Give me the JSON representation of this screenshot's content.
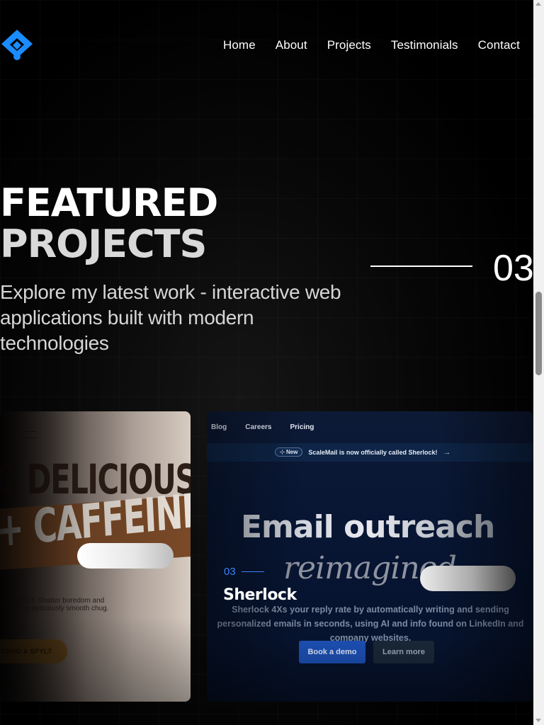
{
  "nav": {
    "items": [
      "Home",
      "About",
      "Projects",
      "Testimonials",
      "Contact"
    ]
  },
  "logo": {
    "icon": "diamond-logo-icon",
    "color": "#1a8cff"
  },
  "hero": {
    "title_line1": "FEATURED",
    "title_line2": "PROJECTS",
    "subtitle": "Explore my latest work - interactive web applications built with modern technologies",
    "counter": "03"
  },
  "cards": {
    "left": {
      "headline1": "G DELICIOUS",
      "headline2": "+ CAFFEINE",
      "copy_line1": "ng SPYLT: Shatter boredom and",
      "copy_line2": "ith every deliciously smooth chug.",
      "button": "CHUG A SPYLT"
    },
    "right": {
      "nav": [
        "Blog",
        "Careers",
        "Pricing"
      ],
      "badge": "New",
      "announcement": "ScaleMail is now officially called Sherlock!",
      "headline": "Email outreach",
      "headline_italic": "reimagined",
      "description": "Sherlock 4Xs your reply rate by automatically writing and sending personalized emails in seconds, using AI and info found on LinkedIn and company websites.",
      "primary_button": "Book a demo",
      "secondary_button": "Learn more"
    }
  },
  "active_project": {
    "number": "03",
    "title": "Sherlock",
    "accent": "#3b82f6"
  }
}
